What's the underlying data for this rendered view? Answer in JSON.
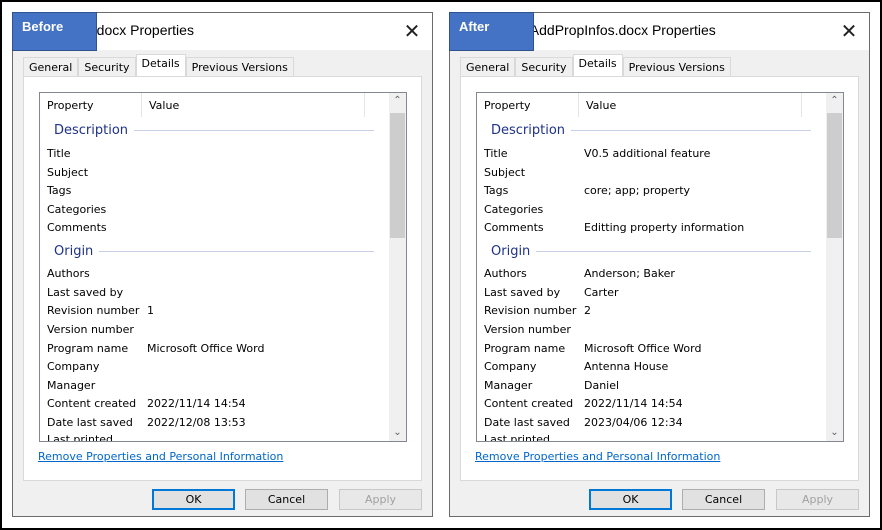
{
  "dialogs": [
    {
      "badge": "Before",
      "title": "e.docx Properties",
      "tabs": [
        "General",
        "Security",
        "Details",
        "Previous Versions"
      ],
      "headers": {
        "property": "Property",
        "value": "Value"
      },
      "groups": [
        "Description",
        "Origin"
      ],
      "rows": [
        [
          "Title",
          ""
        ],
        [
          "Subject",
          ""
        ],
        [
          "Tags",
          ""
        ],
        [
          "Categories",
          ""
        ],
        [
          "Comments",
          ""
        ],
        [
          "Authors",
          ""
        ],
        [
          "Last saved by",
          ""
        ],
        [
          "Revision number",
          "1"
        ],
        [
          "Version number",
          ""
        ],
        [
          "Program name",
          "Microsoft Office Word"
        ],
        [
          "Company",
          ""
        ],
        [
          "Manager",
          ""
        ],
        [
          "Content created",
          "2022/11/14 14:54"
        ],
        [
          "Date last saved",
          "2022/12/08 13:53"
        ],
        [
          "Last printed",
          ""
        ]
      ],
      "link": "Remove Properties and Personal Information",
      "buttons": {
        "ok": "OK",
        "cancel": "Cancel",
        "apply": "Apply"
      }
    },
    {
      "badge": "After",
      "title": "nAddPropInfos.docx Properties",
      "tabs": [
        "General",
        "Security",
        "Details",
        "Previous Versions"
      ],
      "headers": {
        "property": "Property",
        "value": "Value"
      },
      "groups": [
        "Description",
        "Origin"
      ],
      "rows": [
        [
          "Title",
          "V0.5 additional feature"
        ],
        [
          "Subject",
          ""
        ],
        [
          "Tags",
          "core; app; property"
        ],
        [
          "Categories",
          ""
        ],
        [
          "Comments",
          "Editting property information"
        ],
        [
          "Authors",
          "Anderson; Baker"
        ],
        [
          "Last saved by",
          "Carter"
        ],
        [
          "Revision number",
          "2"
        ],
        [
          "Version number",
          ""
        ],
        [
          "Program name",
          "Microsoft Office Word"
        ],
        [
          "Company",
          "Antenna House"
        ],
        [
          "Manager",
          "Daniel"
        ],
        [
          "Content created",
          "2022/11/14 14:54"
        ],
        [
          "Date last saved",
          "2023/04/06 12:34"
        ],
        [
          "Last printed",
          ""
        ]
      ],
      "link": "Remove Properties and Personal Information",
      "buttons": {
        "ok": "OK",
        "cancel": "Cancel",
        "apply": "Apply"
      }
    }
  ],
  "colors": {
    "badge": "#4472c4",
    "group": "#1e3287",
    "link": "#0066cc"
  }
}
